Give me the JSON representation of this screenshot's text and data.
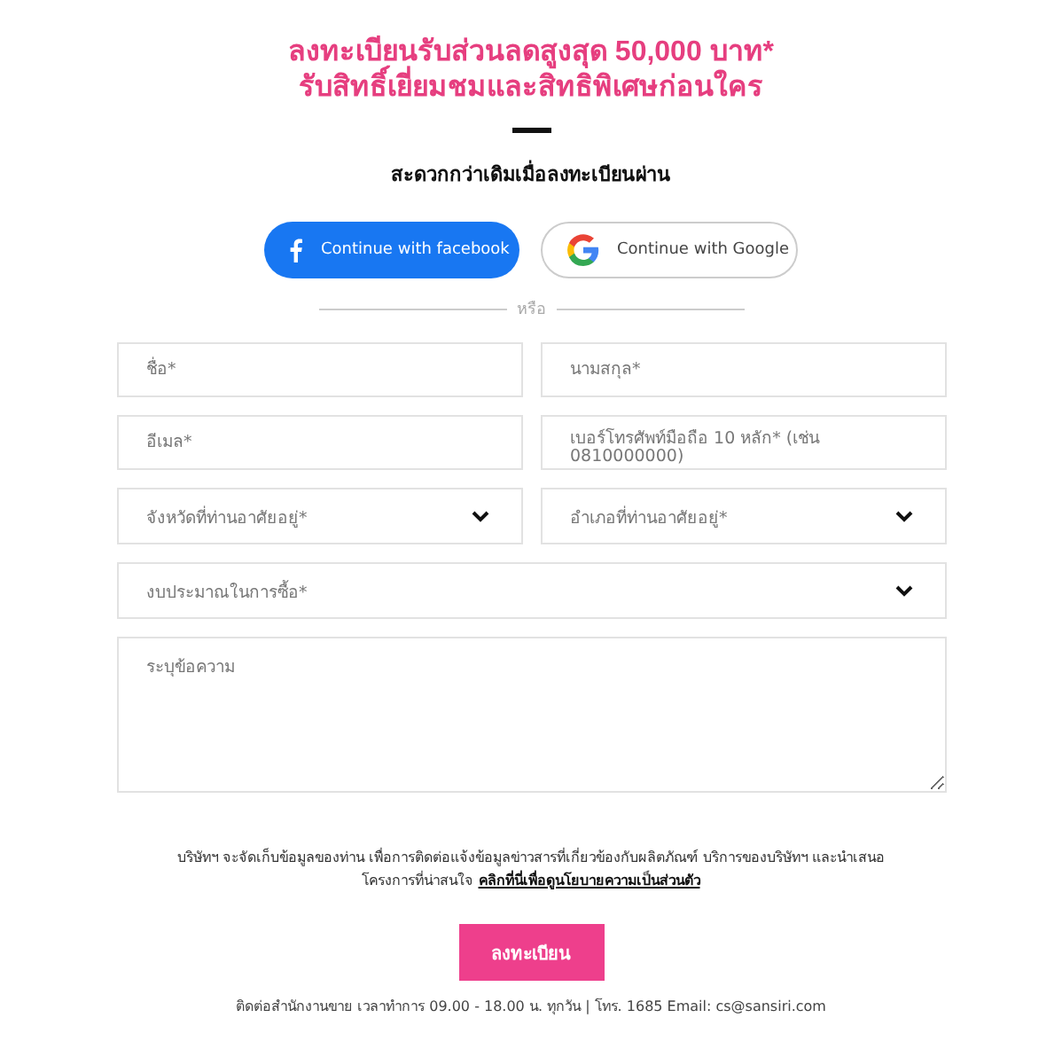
{
  "heading": {
    "lines": [
      "ลงทะเบียนรับส่วนลดสูงสุด 50,000 บาท*",
      "รับสิทธิ์เยี่ยมชมและสิทธิพิเศษก่อนใคร"
    ]
  },
  "subtitle": "สะดวกกว่าเดิมเมื่อลงทะเบียนผ่าน",
  "social_buttons": [
    {
      "kind": "facebook",
      "label": "Continue with facebook"
    },
    {
      "kind": "google",
      "label": "Continue with Google"
    }
  ],
  "divider": "หรือ",
  "field_rows": [
    [
      {
        "kind": "text",
        "placeholder": "ชื่อ*"
      },
      {
        "kind": "text",
        "placeholder": "นามสกุล*"
      }
    ],
    [
      {
        "kind": "text",
        "placeholder": "อีเมล*"
      },
      {
        "kind": "text",
        "placeholder": "เบอร์โทรศัพท์มือถือ 10 หลัก* (เช่น 0810000000)"
      }
    ],
    [
      {
        "kind": "select",
        "placeholder": "จังหวัดที่ท่านอาศัยอยู่*"
      },
      {
        "kind": "select",
        "placeholder": "อำเภอที่ท่านอาศัยอยู่*"
      }
    ],
    [
      {
        "kind": "select",
        "placeholder": "งบประมาณในการซื้อ*"
      }
    ],
    [
      {
        "kind": "textarea",
        "placeholder": "ระบุข้อความ"
      }
    ]
  ],
  "consent": {
    "text": "บริษัทฯ จะจัดเก็บข้อมูลของท่าน เพื่อการติดต่อแจ้งข้อมูลข่าวสารที่เกี่ยวข้องกับผลิตภัณฑ์ บริการของบริษัทฯ และนำเสนอโครงการที่น่าสนใจ",
    "link": "คลิกที่นี่เพื่อดูนโยบายความเป็นส่วนตัว"
  },
  "submit": "ลงทะเบียน",
  "footer": "ติดต่อสำนักงานขาย เวลาทำการ 09.00 - 18.00 น. ทุกวัน | โทร. 1685 Email: cs@sansiri.com"
}
